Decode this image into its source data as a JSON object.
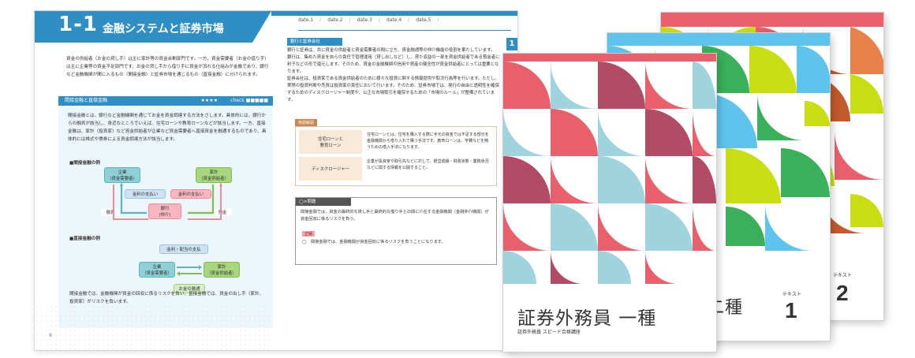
{
  "spread": {
    "chapter_number": "1-1",
    "chapter_title": "金融システムと証券市場",
    "dates": [
      "date.1",
      "date.2",
      "date.3",
      "date.4",
      "date.5"
    ],
    "side_tab": "1",
    "intro_text": "資金の供給者（お金の貸し手）は主に家計等の資金余剰部門です。一方、資金需要者（お金の借り手）は主に企業等の資金不足部門です。お金の貸し手から借り手に資金が流れる仕組みが金融であり、銀行など金融機関が間に入るもの（間接金融）と証券市場を通じるもの（直接金融）に分けられます。",
    "section_title": "間接金融と直接金融",
    "section_stars": "★★★★",
    "section_check": "check ■■■■■",
    "section_text": "間接金融とは、銀行など金融機関を通じてお金を資金調達する方法をさします。具体的には、銀行からの融資が該当し、身近なところでいえば、住宅ローンや教育ローンなどが該当します。一方、直接金融は、家計（投資家）など資金供給者が企業など資金需要者へ直接資金を融通するものであり、具体的には株式や債券による資金調達方法が該当します。",
    "diagram1_title": "■間接金融の例",
    "diagram1": {
      "company": "企業\n（資金需要者）",
      "household": "家計\n（資金供給者）",
      "interest_pay": "金利の支払い",
      "interest_pay2": "金利の支払い",
      "bank": "銀行\n(仲介)",
      "loan": "融資",
      "deposit": "預金"
    },
    "diagram2_title": "■直接金融の例",
    "diagram2": {
      "dividend": "金利・配当の支払",
      "company": "企業\n（資金需要者）",
      "household": "家計\n（資金供給者）",
      "flow": "お金の融通"
    },
    "bottom_text": "間接金融では、金融機関が資金の回収に係るリスクを負い、直接金融では、資金の出し手（家計、投資家）がリスクを負います。",
    "page_no": "8",
    "right_head": "銀行と証券会社",
    "right_text": "銀行と証券は、共に資金の供給者と資金需要者の間に立ち、資金融通等の仲介機能の役割を果たしています。\n銀行は、集めた資金を自らの責任で管理運用（貸し出しなど）し、貸た収益の一部を資金供給者である預金者に利子などの形で還元します。そのため、資金の金融機関の信用や資産の健全性が資金供給者にとっては重要となります。\n証券会社は、投資家である資金供給者のために様々な投資に関する情報提供や取次行為等を行います。ただし、実際の投資判断や売買は投資家の責任において行います。そのため、証券市場では、発行の自由と透明性を確保するためのディスクロージャー制度や、公正な市場取引を確保するための「市場のルール」が整備されています。",
    "glossary_head": "用語解説",
    "glossary": [
      {
        "term": "住宅ローンと\n教育ローン",
        "def": "住宅ローンとは、住宅を購入する際に手元の資金では不足する部分を金融機関から借り入れて購う手法です。教育ローンは、学費などを賄うための借入手法になります。"
      },
      {
        "term": "ディスクロージャー",
        "def": "企業が投資家や取引先などに対して、経営成績・財政状態・業務状況などに関する情報を公開すること。"
      }
    ],
    "quiz_head": "◯×問題",
    "quiz_question": "間接金融では、資金の最終的な貸し手と最終的な借り手との間に介在する金融機関（金融仲介機関）が資金回収に係るリスクを負う。",
    "quiz_answer_label": "正解",
    "quiz_answer": "◯　間接金融では、金融機関が資金回収に係るリスクを負うことになります。"
  },
  "books": {
    "front_title": "証券外務員 一種",
    "front_subtitle": "証券外務員 スピード合格講座",
    "middle_title_partial": "二種",
    "middle_vol_label": "テキスト",
    "middle_vol": "1",
    "back_vol_label": "テキスト",
    "back_vol": "2"
  },
  "colors": {
    "accent_blue": "#2f8fc4",
    "cover_pink": "#e8606c",
    "cover_teal": "#9fd3de",
    "cover_mauve": "#b24b66",
    "cover_lime": "#c8dd12",
    "cover_green": "#3ab05a",
    "cover_sky": "#5ec4ec",
    "cover_orange": "#e8824a",
    "cover_rust": "#c45a2a"
  }
}
